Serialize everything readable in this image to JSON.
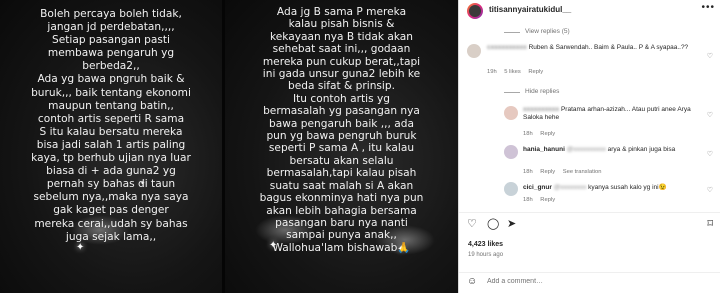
{
  "media": {
    "slide1_text": "Boleh percaya boleh tidak,\njangan jd perdebatan,,,,\nSetiap pasangan pasti\nmembawa pengaruh yg\nberbeda2,,\nAda yg bawa pngruh baik &\nburuk,,, baik tentang ekonomi\nmaupun tentang batin,,\ncontoh artis seperti R sama\nS itu kalau bersatu mereka\nbisa jadi salah 1 artis paling\nkaya, tp berhub ujian nya luar\nbiasa di + ada guna2 yg\npernah sy bahas di taun\nsebelum nya,,maka nya saya\ngak kaget pas denger\nmereka cerai,,udah sy bahas\njuga sejak lama,,",
    "slide2_text": "Ada jg B sama P mereka\nkalau pisah bisnis &\nkekayaan nya B tidak akan\nsehebat saat ini,,, godaan\nmereka pun cukup berat,,tapi\nini gada unsur guna2 lebih ke\nbeda sifat & prinsip.\nItu contoh artis yg\nbermasalah yg pasangan nya\nbawa pengaruh baik ,,, ada\npun yg bawa pengruh buruk\nseperti P sama A , itu kalau\nbersatu akan selalu\nbermasalah,tapi kalau pisah\nsuatu saat malah si A akan\nbagus ekonminya hati nya pun\nakan lebih bahagia bersama\npasangan baru nya nanti\nsampai punya anak,,\nWallohua'lam bishawab🙏"
  },
  "header": {
    "username": "titisannyairatukidul__",
    "more_icon": "more-horizontal-icon"
  },
  "comments": {
    "view_replies_top": "View replies (5)",
    "c1": {
      "user": "cxxxxxxxxxx",
      "text": "Ruben & Sarwendah.. Baim & Paula.. P & A syapaa..??",
      "time": "19h",
      "likes": "5 likes",
      "reply": "Reply"
    },
    "hide_replies": "Hide replies",
    "r1": {
      "user": "xxxxxxxxxx",
      "text": "Pratama arhan-azizah... Atau putri anee Arya Saloka hehe",
      "time": "18h",
      "reply": "Reply"
    },
    "r2": {
      "user": "hania_hanuni",
      "mention": "@xxxxxxxxxx",
      "text": "arya & pinkan juga bisa",
      "time": "18h",
      "reply": "Reply",
      "see_translation": "See translation"
    },
    "r3": {
      "user": "cici_gnur",
      "mention": "@xxxxxxxx",
      "text": "kyanya susah kalo yg ini😉",
      "time": "18h",
      "reply": "Reply"
    }
  },
  "actions": {
    "like_icon": "heart-icon",
    "comment_icon": "comment-icon",
    "share_icon": "share-icon",
    "save_icon": "bookmark-icon"
  },
  "likes": "4,423 likes",
  "posted": "19 hours ago",
  "add_comment": {
    "placeholder": "Add a comment…",
    "emoji_icon": "emoji-icon"
  }
}
